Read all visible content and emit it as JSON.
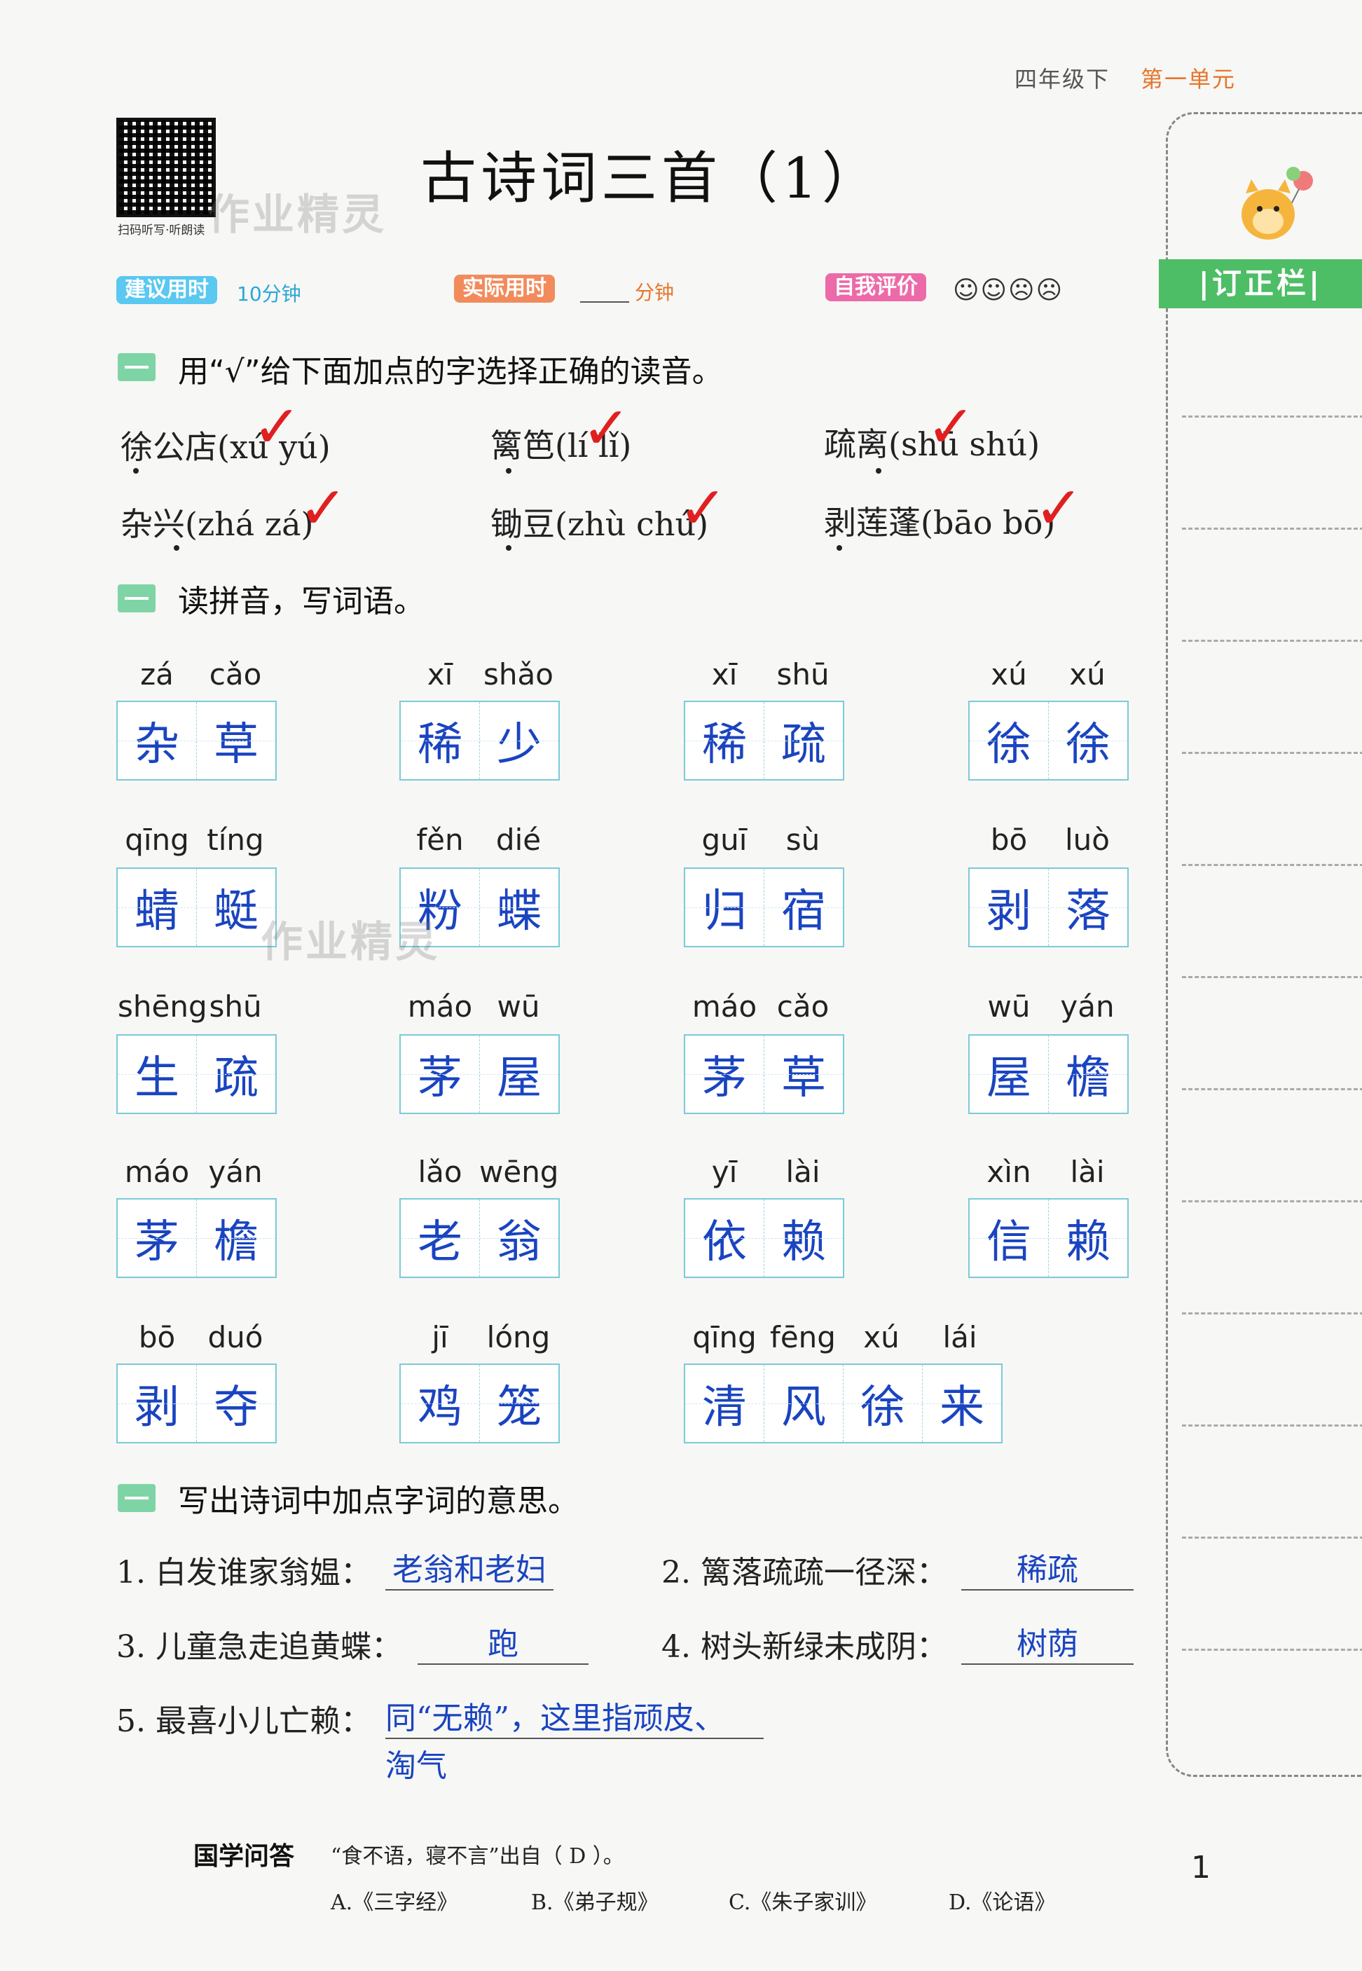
{
  "header": {
    "grade": "四年级下",
    "unit": "第一单元"
  },
  "qr": {
    "caption": "扫码听写·听朗读",
    "watermark": "作业精灵"
  },
  "title": "古诗词三首（1）",
  "timing": {
    "suggest_label": "建议用时",
    "suggest_value": "10分钟",
    "actual_label": "实际用时",
    "actual_unit": "分钟",
    "self_label": "自我评价",
    "faces": "☺☺☹☹"
  },
  "section1": {
    "heading": "用“√”给下面加点的字选择正确的读音。",
    "items": [
      {
        "text": "徐公店(xú  yú)",
        "check": "✓"
      },
      {
        "text": "篱笆(lí  lǐ)",
        "check": "✓"
      },
      {
        "text": "疏离(shū  shú)",
        "check": "✓"
      },
      {
        "text": "杂兴(zhá  zá)",
        "check": "✓"
      },
      {
        "text": "锄豆(zhù  chú)",
        "check": "✓"
      },
      {
        "text": "剥莲蓬(bāo  bō)",
        "check": "✓"
      }
    ]
  },
  "section2": {
    "heading": "读拼音，写词语。",
    "watermark": "作业精灵",
    "rows": [
      [
        {
          "py": [
            "zá",
            "cǎo"
          ],
          "chars": [
            "杂",
            "草"
          ]
        },
        {
          "py": [
            "xī",
            "shǎo"
          ],
          "chars": [
            "稀",
            "少"
          ]
        },
        {
          "py": [
            "xī",
            "shū"
          ],
          "chars": [
            "稀",
            "疏"
          ]
        },
        {
          "py": [
            "xú",
            "xú"
          ],
          "chars": [
            "徐",
            "徐"
          ]
        }
      ],
      [
        {
          "py": [
            "qīng",
            "tíng"
          ],
          "chars": [
            "蜻",
            "蜓"
          ]
        },
        {
          "py": [
            "fěn",
            "dié"
          ],
          "chars": [
            "粉",
            "蝶"
          ]
        },
        {
          "py": [
            "guī",
            "sù"
          ],
          "chars": [
            "归",
            "宿"
          ]
        },
        {
          "py": [
            "bō",
            "luò"
          ],
          "chars": [
            "剥",
            "落"
          ]
        }
      ],
      [
        {
          "py": [
            "shēng",
            "shū"
          ],
          "chars": [
            "生",
            "疏"
          ]
        },
        {
          "py": [
            "máo",
            "wū"
          ],
          "chars": [
            "茅",
            "屋"
          ]
        },
        {
          "py": [
            "máo",
            "cǎo"
          ],
          "chars": [
            "茅",
            "草"
          ]
        },
        {
          "py": [
            "wū",
            "yán"
          ],
          "chars": [
            "屋",
            "檐"
          ]
        }
      ],
      [
        {
          "py": [
            "máo",
            "yán"
          ],
          "chars": [
            "茅",
            "檐"
          ]
        },
        {
          "py": [
            "lǎo",
            "wēng"
          ],
          "chars": [
            "老",
            "翁"
          ]
        },
        {
          "py": [
            "yī",
            "lài"
          ],
          "chars": [
            "依",
            "赖"
          ]
        },
        {
          "py": [
            "xìn",
            "lài"
          ],
          "chars": [
            "信",
            "赖"
          ]
        }
      ],
      [
        {
          "py": [
            "bō",
            "duó"
          ],
          "chars": [
            "剥",
            "夺"
          ]
        },
        {
          "py": [
            "jī",
            "lóng"
          ],
          "chars": [
            "鸡",
            "笼"
          ]
        },
        {
          "py": [
            "qīng",
            "fēng",
            "xú",
            "lái"
          ],
          "chars": [
            "清",
            "风",
            "徐",
            "来"
          ]
        }
      ]
    ]
  },
  "section3": {
    "heading": "写出诗词中加点字词的意思。",
    "items": [
      {
        "q": "1. 白发谁家翁媪：",
        "a": "老翁和老妇"
      },
      {
        "q": "2. 篱落疏疏一径深：",
        "a": "稀疏"
      },
      {
        "q": "3. 儿童急走追黄蝶：",
        "a": "跑"
      },
      {
        "q": "4. 树头新绿未成阴：",
        "a": "树荫"
      },
      {
        "q": "5. 最喜小儿亡赖：",
        "a": "同“无赖”，这里指顽皮、",
        "a2": "淘气"
      }
    ]
  },
  "guoxue": {
    "title": "国学问答",
    "question": "“食不语，寝不言”出自（ D ）。",
    "options": [
      "A.《三字经》",
      "B.《弟子规》",
      "C.《朱子家训》",
      "D.《论语》"
    ]
  },
  "page_number": "1",
  "sidebar": {
    "label": "|订正栏|"
  }
}
